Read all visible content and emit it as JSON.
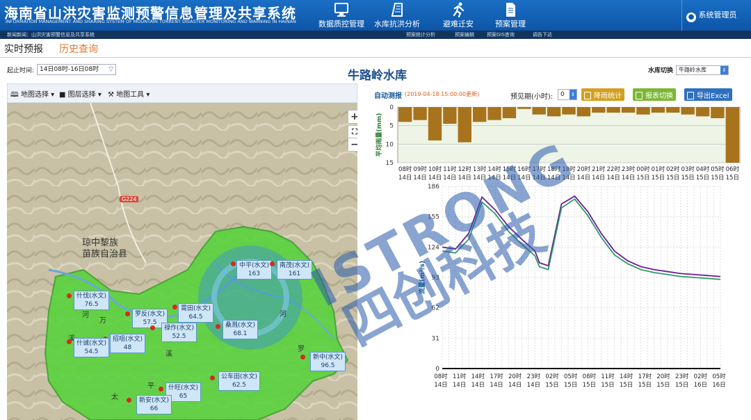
{
  "header": {
    "title": "海南省山洪灾害监测预警信息管理及共享系统",
    "subtitle": "INFORMATION MANAGEMENT AND SHARING SYSTEM OF MOUNTAIN TORRENT DISASTER MONITORING AND WARNING IN HAINAN",
    "nav": [
      {
        "label": "数据质控管理",
        "icon": "monitor-icon"
      },
      {
        "label": "水库抗洪分析",
        "icon": "dam-icon"
      },
      {
        "label": "避难迁安",
        "icon": "running-person-icon"
      },
      {
        "label": "预案管理",
        "icon": "document-icon"
      }
    ],
    "user": "系统管理员"
  },
  "ticker": [
    "新闻新闻：山洪灾害预警信息及共享系统",
    "预案统计分析",
    "预案编辑",
    "预案GIS查询",
    "调告下达"
  ],
  "tabs": {
    "active": "实时预报",
    "other": "历史查询"
  },
  "filter": {
    "time_label": "起止时间:",
    "time_value": "14日08时-16日08时",
    "reservoir_title": "牛路岭水库",
    "switch_label": "水库切换",
    "switch_value": "牛路岭水库"
  },
  "map_tools": [
    "地图选择",
    "图层选择",
    "地图工具"
  ],
  "map": {
    "labels": [
      "琼中黎族",
      "苗族自治县",
      "万",
      "河",
      "溪",
      "河",
      "平",
      "太",
      "罗",
      "河",
      "溪"
    ],
    "road": "G224",
    "stations": [
      {
        "name": "中平(水文)",
        "value": "163"
      },
      {
        "name": "南茂(水文)",
        "value": "161"
      },
      {
        "name": "什伐(水文)",
        "value": "76.5"
      },
      {
        "name": "罗反(水文)",
        "value": "57.5"
      },
      {
        "name": "霄田(水文)",
        "value": "64.5"
      },
      {
        "name": "禄作(水文)",
        "value": "52.5"
      },
      {
        "name": "桑溅(水文)",
        "value": "68.1"
      },
      {
        "name": "招咀(水文)",
        "value": "48"
      },
      {
        "name": "什诚(水文)",
        "value": "54.5"
      },
      {
        "name": "新中(水文)",
        "value": "96.5"
      },
      {
        "name": "公车田(水文)",
        "value": "62.5"
      },
      {
        "name": "什旺(水文)",
        "value": "65"
      },
      {
        "name": "新安(水文)",
        "value": "66"
      }
    ]
  },
  "forecast": {
    "auto_label": "自动测报",
    "updated": "(2019-04-18 15:00:00更新)",
    "period_label": "预见期(小时):",
    "period_value": "0",
    "buttons": [
      {
        "label": "降雨统计",
        "color": "#d2a01f",
        "icon": "bar-chart-icon"
      },
      {
        "label": "报表切换",
        "color": "#7cb733",
        "icon": "table-icon"
      },
      {
        "label": "导出Excel",
        "color": "#2f6fbf",
        "icon": "export-icon"
      }
    ]
  },
  "watermark": {
    "latin": "ISTRONG",
    "chinese": "四创科技"
  },
  "chart_data": [
    {
      "type": "bar",
      "ylabel": "平均雨量(mm)",
      "ylim": [
        0,
        15
      ],
      "yticks": [
        0,
        5,
        10,
        15
      ],
      "inverted": true,
      "categories": [
        "08时14日",
        "09时14日",
        "10时14日",
        "11时14日",
        "12时14日",
        "13时14日",
        "14时14日",
        "15时14日",
        "16时14日",
        "17时14日",
        "18时14日",
        "19时14日",
        "20时14日",
        "21时14日",
        "22时14日",
        "23时14日",
        "00时15日",
        "01时15日",
        "02时15日",
        "03时15日",
        "04时15日",
        "05时15日",
        "06时15日"
      ],
      "values": [
        4,
        3.5,
        9,
        4.5,
        9.5,
        4,
        3.5,
        3,
        0.5,
        2,
        2.5,
        2,
        2.5,
        1.5,
        1.5,
        1.5,
        2,
        1.5,
        1.5,
        2,
        2.5,
        3,
        15
      ],
      "color": "#a8731d",
      "bg": "#eef5e6"
    },
    {
      "type": "line",
      "ylabel": "流量(m³/s)",
      "ylim": [
        0,
        186
      ],
      "yticks": [
        0,
        31,
        62,
        93,
        124,
        155,
        186
      ],
      "xticks": [
        "08时14日",
        "11时14日",
        "14时14日",
        "17时14日",
        "20时14日",
        "23时14日",
        "02时15日",
        "05时15日",
        "08时15日",
        "11时15日",
        "14时15日",
        "17时15日",
        "20时15日",
        "23时15日",
        "02时16日",
        "05时16日"
      ],
      "x": [
        0,
        3,
        6,
        9,
        12,
        15,
        18,
        21,
        22,
        24,
        27,
        30,
        33,
        36,
        39,
        42,
        45,
        48,
        51,
        54,
        57,
        60,
        63
      ],
      "series": [
        {
          "color": "#6a1e9a",
          "values": [
            124,
            122,
            138,
            175,
            162,
            145,
            132,
            120,
            108,
            105,
            168,
            176,
            160,
            138,
            120,
            110,
            104,
            101,
            99,
            97,
            96,
            95,
            94
          ]
        },
        {
          "color": "#2e9a6a",
          "values": [
            120,
            118,
            132,
            170,
            158,
            140,
            127,
            115,
            104,
            101,
            164,
            173,
            156,
            134,
            116,
            107,
            101,
            98,
            96,
            94,
            93,
            92,
            91
          ]
        }
      ]
    }
  ]
}
